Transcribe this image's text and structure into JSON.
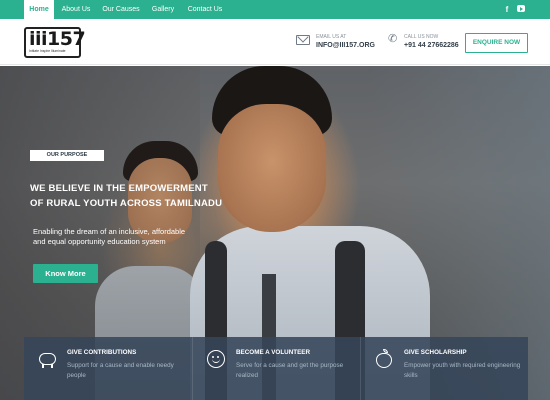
{
  "nav": {
    "items": [
      {
        "label": "Home",
        "active": true
      },
      {
        "label": "About Us",
        "active": false
      },
      {
        "label": "Our Causes",
        "active": false
      },
      {
        "label": "Gallery",
        "active": false
      },
      {
        "label": "Contact Us",
        "active": false
      }
    ],
    "social": {
      "facebook_glyph": "f",
      "youtube_icon": "youtube-icon"
    },
    "accent_color": "#2bb090"
  },
  "header": {
    "logo_text": "iii157",
    "logo_tagline": "Initiate Inspire Illuminate",
    "email": {
      "label": "EMAIL US AT",
      "value": "INFO@III157.ORG",
      "icon": "envelope-icon"
    },
    "phone": {
      "label": "CALL US NOW",
      "value": "+91 44 27662286",
      "icon": "phone-icon"
    },
    "enquire_label": "ENQUIRE NOW"
  },
  "hero": {
    "tag": "OUR PURPOSE",
    "headline_line1": "WE BELIEVE IN THE EMPOWERMENT",
    "headline_line2": "OF RURAL YOUTH ACROSS TAMILNADU",
    "subline_line1": "Enabling the dream of an inclusive, affordable",
    "subline_line2": "and equal opportunity education system",
    "cta_label": "Know More"
  },
  "features": [
    {
      "icon": "piggy-bank-icon",
      "title": "GIVE CONTRIBUTIONS",
      "desc": "Support for a cause and enable needy people"
    },
    {
      "icon": "smile-icon",
      "title": "BECOME A VOLUNTEER",
      "desc": "Serve for a cause and get the purpose realized"
    },
    {
      "icon": "apple-icon",
      "title": "GIVE SCHOLARSHIP",
      "desc": "Empower youth with required engineering skills"
    }
  ]
}
